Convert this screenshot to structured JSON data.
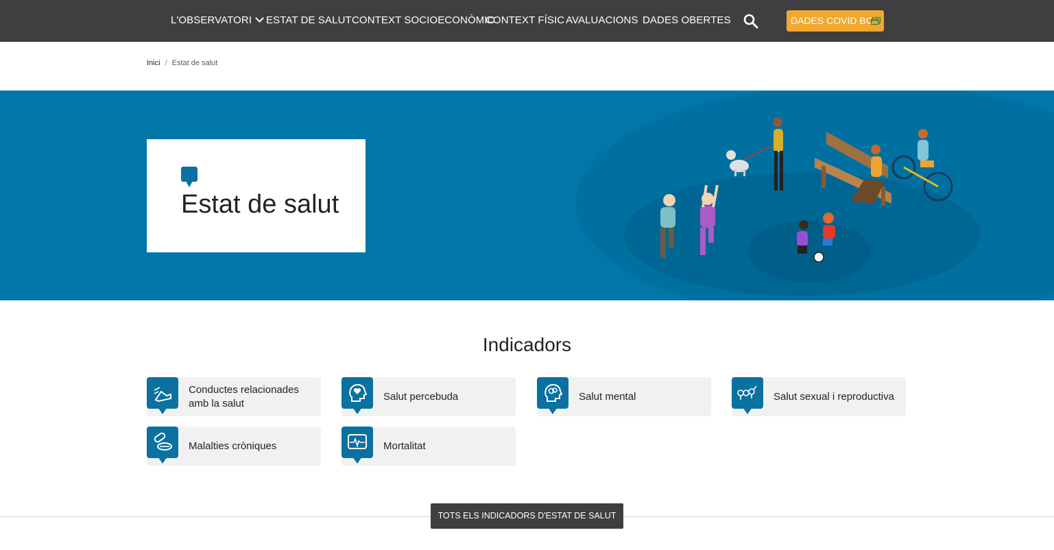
{
  "nav": {
    "items": [
      {
        "label": "L'OBSERVATORI",
        "has_dropdown": true
      },
      {
        "label": "ESTAT DE SALUT"
      },
      {
        "label": "CONTEXT SOCIOECONÒMIC"
      },
      {
        "label": "CONTEXT FÍSIC"
      },
      {
        "label": "AVALUACIONS"
      },
      {
        "label": "DADES OBERTES"
      }
    ],
    "search_icon": "search-icon",
    "covid_button": {
      "label": "DADES COVID BCN",
      "icon": "external-window-icon",
      "color": "#f0a830"
    },
    "background": "#3f3e40"
  },
  "breadcrumb": {
    "home": "Inici",
    "separator": "/",
    "current": "Estat de salut"
  },
  "hero": {
    "title": "Estat de salut",
    "background": "#0077a8",
    "icon": "speech-bubble-icon"
  },
  "indicators": {
    "title": "Indicadors",
    "items": [
      {
        "label": "Conductes relacionades amb la salut",
        "icon": "running-shoe-icon"
      },
      {
        "label": "Salut percebuda",
        "icon": "head-heart-icon"
      },
      {
        "label": "Salut mental",
        "icon": "head-brain-icon"
      },
      {
        "label": "Salut sexual i reproductiva",
        "icon": "gender-symbols-icon"
      },
      {
        "label": "Malalties cròniques",
        "icon": "pills-icon"
      },
      {
        "label": "Mortalitat",
        "icon": "heartbeat-monitor-icon"
      }
    ],
    "accent": "#0b71a1"
  },
  "footer_button": {
    "label": "TOTS ELS INDICADORS D'ESTAT DE SALUT"
  }
}
